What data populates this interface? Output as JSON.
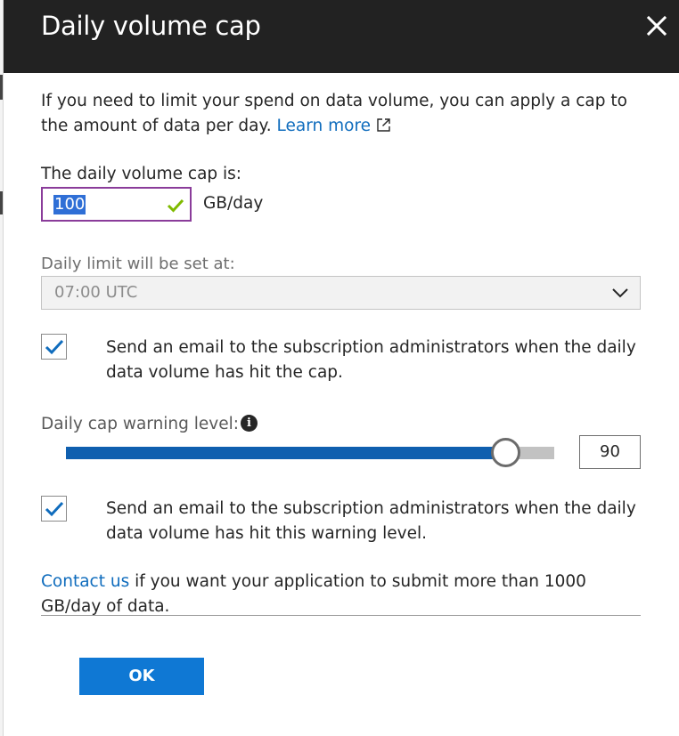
{
  "header": {
    "title": "Daily volume cap",
    "close_icon": "close-icon"
  },
  "intro": {
    "text": "If you need to limit your spend on data volume, you can apply a cap to the amount of data per day.",
    "learn_more": "Learn more",
    "learn_more_icon": "external-link-icon"
  },
  "cap": {
    "label": "The daily volume cap is:",
    "value": "100",
    "unit": "GB/day",
    "valid_icon": "checkmark-icon"
  },
  "limit": {
    "label": "Daily limit will be set at:",
    "selected": "07:00 UTC",
    "chevron_icon": "chevron-down-icon"
  },
  "email_cap": {
    "checked": true,
    "text": "Send an email to the subscription administrators when the daily data volume has hit the cap."
  },
  "warning": {
    "label": "Daily cap warning level:",
    "info_icon": "info-icon",
    "info_glyph": "i",
    "slider_fraction": 0.9,
    "value": "90"
  },
  "email_warning": {
    "checked": true,
    "text": "Send an email to the subscription administrators when the daily data volume has hit this warning level."
  },
  "contact": {
    "link": "Contact us",
    "text": " if you want your application to submit more than 1000 GB/day of data."
  },
  "footer": {
    "ok_label": "OK"
  },
  "colors": {
    "header_bg": "#222222",
    "link": "#0f6cbd",
    "primary_button": "#0f78d4",
    "slider_fill": "#0f5faf",
    "input_focus_border": "#8a3c9a",
    "checkmark": "#7fba00"
  }
}
